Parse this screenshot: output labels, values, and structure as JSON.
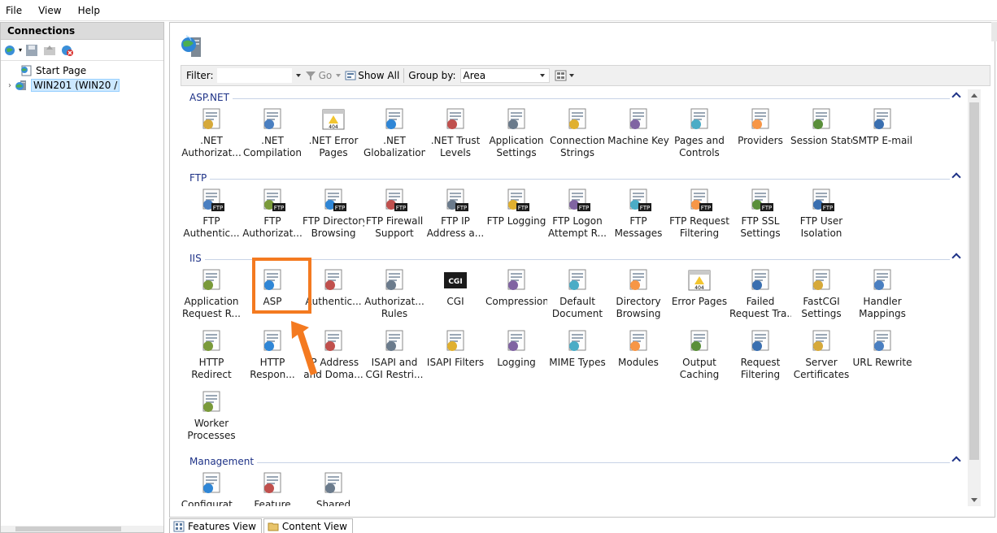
{
  "menu": {
    "items": [
      "File",
      "View",
      "Help"
    ]
  },
  "connections": {
    "title": "Connections",
    "tree": [
      {
        "label": "Start Page"
      },
      {
        "label": "WIN201          (WIN20     /"
      }
    ]
  },
  "filterbar": {
    "filter_label": "Filter:",
    "go_label": "Go",
    "show_all_label": "Show All",
    "group_by_label": "Group by:",
    "group_by_value": "Area"
  },
  "groups": [
    {
      "title": "ASP.NET",
      "items": [
        {
          "label": ".NET\nAuthorizat...",
          "icon": "dotnet-authorization-icon"
        },
        {
          "label": ".NET\nCompilation",
          "icon": "dotnet-compilation-icon"
        },
        {
          "label": ".NET Error\nPages",
          "icon": "dotnet-error-pages-icon"
        },
        {
          "label": ".NET\nGlobalization",
          "icon": "dotnet-globalization-icon"
        },
        {
          "label": ".NET Trust\nLevels",
          "icon": "dotnet-trust-levels-icon"
        },
        {
          "label": "Application\nSettings",
          "icon": "application-settings-icon"
        },
        {
          "label": "Connection\nStrings",
          "icon": "connection-strings-icon"
        },
        {
          "label": "Machine Key",
          "icon": "machine-key-icon"
        },
        {
          "label": "Pages and\nControls",
          "icon": "pages-controls-icon"
        },
        {
          "label": "Providers",
          "icon": "providers-icon"
        },
        {
          "label": "Session State",
          "icon": "session-state-icon"
        },
        {
          "label": "SMTP E-mail",
          "icon": "smtp-email-icon"
        }
      ]
    },
    {
      "title": "FTP",
      "items": [
        {
          "label": "FTP\nAuthentic...",
          "icon": "ftp-authentication-icon"
        },
        {
          "label": "FTP\nAuthorizat...",
          "icon": "ftp-authorization-icon"
        },
        {
          "label": "FTP Directory\nBrowsing",
          "icon": "ftp-directory-browsing-icon"
        },
        {
          "label": "FTP Firewall\nSupport",
          "icon": "ftp-firewall-icon"
        },
        {
          "label": "FTP IP\nAddress a...",
          "icon": "ftp-ip-address-icon"
        },
        {
          "label": "FTP Logging",
          "icon": "ftp-logging-icon"
        },
        {
          "label": "FTP Logon\nAttempt R...",
          "icon": "ftp-logon-attempt-icon"
        },
        {
          "label": "FTP\nMessages",
          "icon": "ftp-messages-icon"
        },
        {
          "label": "FTP Request\nFiltering",
          "icon": "ftp-request-filtering-icon"
        },
        {
          "label": "FTP SSL\nSettings",
          "icon": "ftp-ssl-icon"
        },
        {
          "label": "FTP User\nIsolation",
          "icon": "ftp-user-isolation-icon"
        }
      ]
    },
    {
      "title": "IIS",
      "items": [
        {
          "label": "Application\nRequest R...",
          "icon": "application-request-routing-icon"
        },
        {
          "label": "ASP",
          "icon": "asp-icon"
        },
        {
          "label": "Authentic...",
          "icon": "authentication-icon"
        },
        {
          "label": "Authorizat...\nRules",
          "icon": "authorization-rules-icon"
        },
        {
          "label": "CGI",
          "icon": "cgi-icon"
        },
        {
          "label": "Compression",
          "icon": "compression-icon"
        },
        {
          "label": "Default\nDocument",
          "icon": "default-document-icon"
        },
        {
          "label": "Directory\nBrowsing",
          "icon": "directory-browsing-icon"
        },
        {
          "label": "Error Pages",
          "icon": "error-pages-icon"
        },
        {
          "label": "Failed\nRequest Tra...",
          "icon": "failed-request-tracing-icon"
        },
        {
          "label": "FastCGI\nSettings",
          "icon": "fastcgi-settings-icon"
        },
        {
          "label": "Handler\nMappings",
          "icon": "handler-mappings-icon"
        },
        {
          "label": "HTTP\nRedirect",
          "icon": "http-redirect-icon"
        },
        {
          "label": "HTTP\nRespon...",
          "icon": "http-response-headers-icon"
        },
        {
          "label": "IP Address\nand Doma...",
          "icon": "ip-address-domain-icon"
        },
        {
          "label": "ISAPI and\nCGI Restri...",
          "icon": "isapi-cgi-restrictions-icon"
        },
        {
          "label": "ISAPI Filters",
          "icon": "isapi-filters-icon"
        },
        {
          "label": "Logging",
          "icon": "logging-icon"
        },
        {
          "label": "MIME Types",
          "icon": "mime-types-icon"
        },
        {
          "label": "Modules",
          "icon": "modules-icon"
        },
        {
          "label": "Output\nCaching",
          "icon": "output-caching-icon"
        },
        {
          "label": "Request\nFiltering",
          "icon": "request-filtering-icon"
        },
        {
          "label": "Server\nCertificates",
          "icon": "server-certificates-icon"
        },
        {
          "label": "URL Rewrite",
          "icon": "url-rewrite-icon"
        },
        {
          "label": "Worker\nProcesses",
          "icon": "worker-processes-icon"
        }
      ]
    },
    {
      "title": "Management",
      "items": [
        {
          "label": "Configurat...",
          "icon": "configuration-editor-icon"
        },
        {
          "label": "Feature",
          "icon": "feature-delegation-icon"
        },
        {
          "label": "Shared",
          "icon": "shared-configuration-icon"
        }
      ]
    }
  ],
  "tabs": {
    "features_view": "Features View",
    "content_view": "Content View"
  },
  "colors": {
    "group_title": "#1e3287",
    "highlight": "#f47a20",
    "selection": "#cce8ff"
  }
}
